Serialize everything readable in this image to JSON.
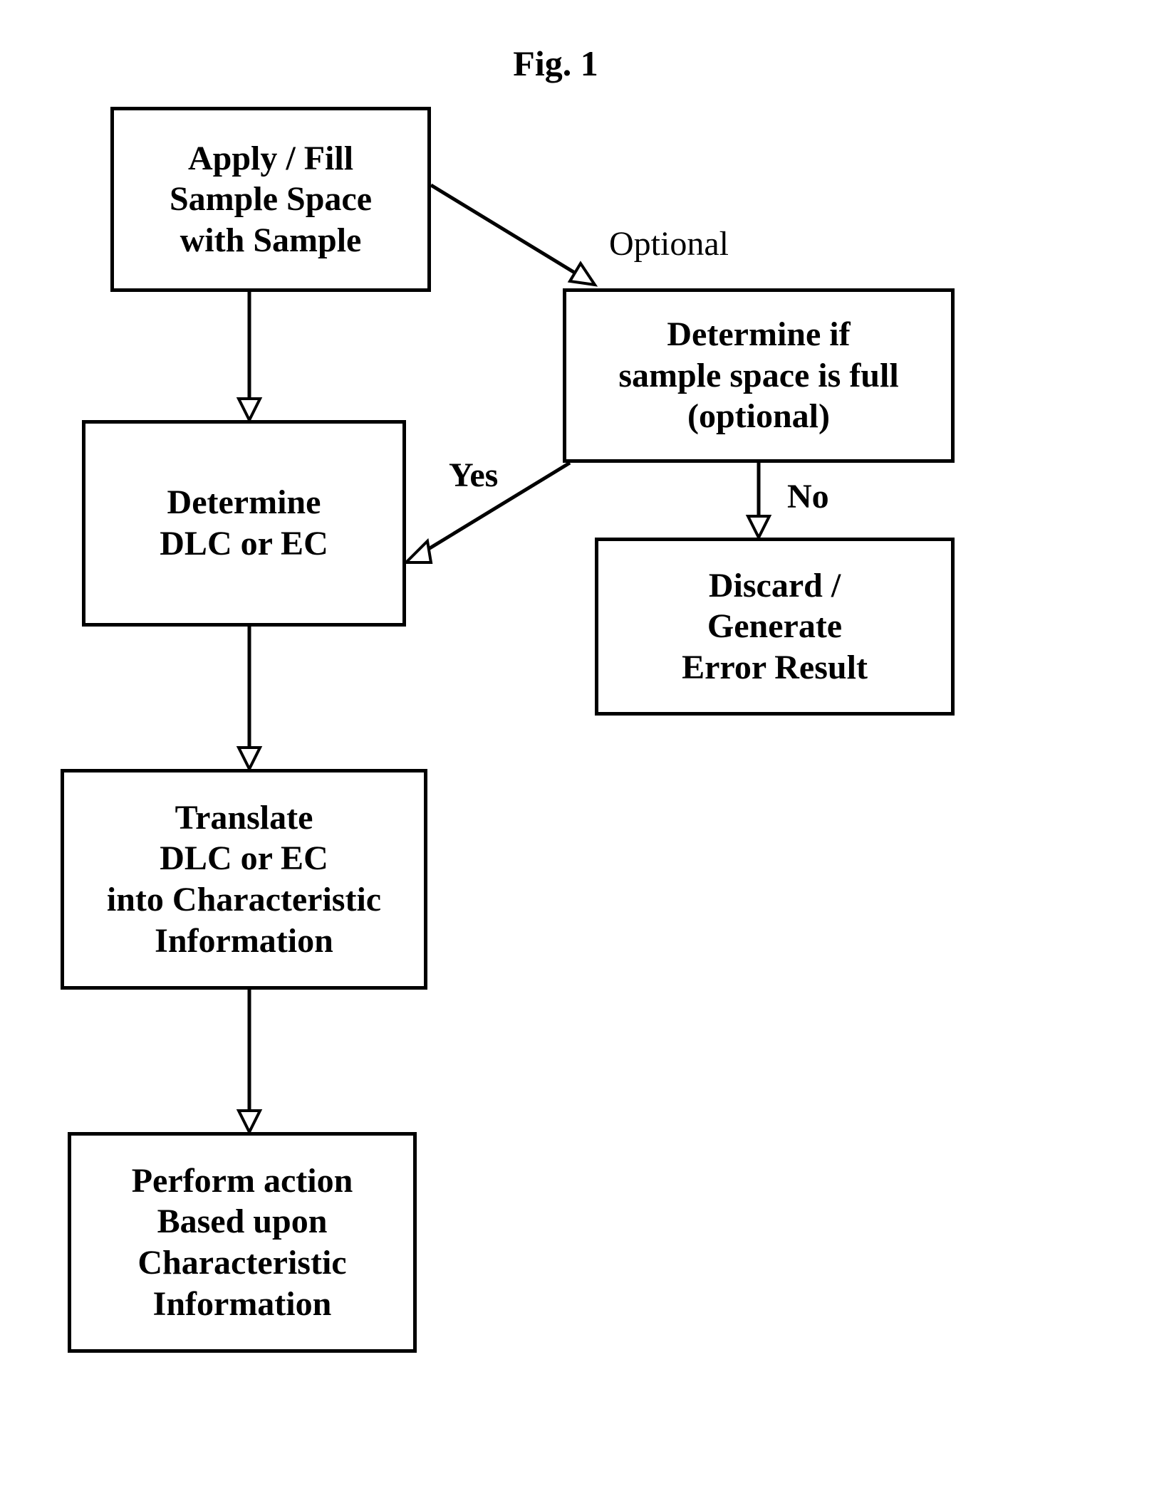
{
  "title": "Fig. 1",
  "boxes": {
    "apply": {
      "line1": "Apply / Fill",
      "line2": "Sample Space",
      "line3": "with Sample"
    },
    "determineDlc": {
      "line1": "Determine",
      "line2": "DLC or EC"
    },
    "translate": {
      "line1": "Translate",
      "line2": "DLC or EC",
      "line3": "into Characteristic",
      "line4": "Information"
    },
    "perform": {
      "line1": "Perform action",
      "line2": "Based upon",
      "line3": "Characteristic",
      "line4": "Information"
    },
    "checkFull": {
      "line1": "Determine if",
      "line2": "sample space is full",
      "line3": "(optional)"
    },
    "discard": {
      "line1": "Discard /",
      "line2": "Generate",
      "line3": "Error Result"
    }
  },
  "labels": {
    "optional": "Optional",
    "yes": "Yes",
    "no": "No"
  },
  "chart_data": {
    "type": "flowchart",
    "nodes": [
      {
        "id": "apply",
        "text": "Apply / Fill Sample Space with Sample"
      },
      {
        "id": "checkFull",
        "text": "Determine if sample space is full (optional)",
        "optional": true
      },
      {
        "id": "determineDlc",
        "text": "Determine DLC or EC"
      },
      {
        "id": "discard",
        "text": "Discard / Generate Error Result"
      },
      {
        "id": "translate",
        "text": "Translate DLC or EC into Characteristic Information"
      },
      {
        "id": "perform",
        "text": "Perform action Based upon Characteristic Information"
      }
    ],
    "edges": [
      {
        "from": "apply",
        "to": "determineDlc"
      },
      {
        "from": "apply",
        "to": "checkFull",
        "label": "Optional"
      },
      {
        "from": "checkFull",
        "to": "determineDlc",
        "label": "Yes"
      },
      {
        "from": "checkFull",
        "to": "discard",
        "label": "No"
      },
      {
        "from": "determineDlc",
        "to": "translate"
      },
      {
        "from": "translate",
        "to": "perform"
      }
    ]
  }
}
